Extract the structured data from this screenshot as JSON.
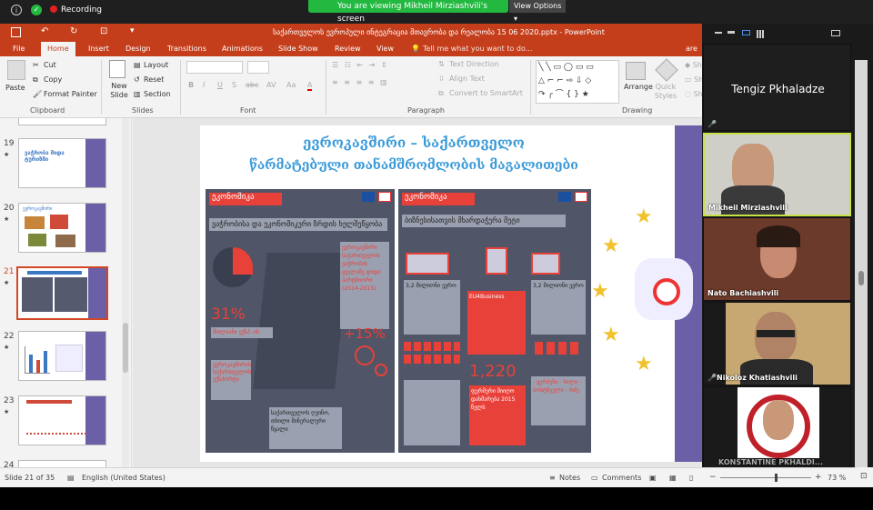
{
  "zoom": {
    "recording": "Recording",
    "viewing_banner": "You are viewing Mikheil Mirziashvili's screen",
    "view_options": "View Options"
  },
  "powerpoint": {
    "title": "საქართველოს ევროპული ინტეგრაცია მთავრობა და რეალობა 15 06 2020.pptx - PowerPoint",
    "tabs": [
      "File",
      "Home",
      "Insert",
      "Design",
      "Transitions",
      "Animations",
      "Slide Show",
      "Review",
      "View"
    ],
    "tell_me": "Tell me what you want to do...",
    "share": "are",
    "ribbon": {
      "paste": "Paste",
      "cut": "Cut",
      "copy": "Copy",
      "format_painter": "Format Painter",
      "clipboard": "Clipboard",
      "new_slide": "New Slide",
      "layout": "Layout",
      "reset": "Reset",
      "section": "Section",
      "slides": "Slides",
      "font": "Font",
      "text_direction": "Text Direction",
      "align_text": "Align Text",
      "convert_smartart": "Convert to SmartArt",
      "paragraph": "Paragraph",
      "arrange": "Arrange",
      "quick_styles": "Quick Styles",
      "drawing": "Drawing",
      "bold": "B",
      "italic": "I",
      "underline": "U",
      "strike": "S",
      "abc": "abc",
      "av": "AV",
      "aa": "Aa",
      "font_color": "A"
    },
    "thumbnails": [
      {
        "num": "19",
        "star": "★",
        "text": "ვაჭრობა შიდა ტურიზმი"
      },
      {
        "num": "20",
        "star": "★",
        "text": "ევროკავშირი"
      },
      {
        "num": "21",
        "star": "★",
        "text": ""
      },
      {
        "num": "22",
        "star": "★",
        "text": ""
      },
      {
        "num": "23",
        "star": "★",
        "text": ""
      },
      {
        "num": "24",
        "star": "★",
        "text": ""
      }
    ],
    "slide": {
      "title_line1": "ევროკავშირი – საქართველო",
      "title_line2": "წარმატებული თანამშრომლობის მაგალითები",
      "left_header": "ეკონომიკა",
      "left_subheader": "ვაჭრობისა და ეკონომიკური ზრდის ხელშეწყობა",
      "left_percent": "31%",
      "left_percent_label": "მთლიანი ექსპ.-ის",
      "left_side_text": "ევროკავშირი საქართველოს ვაჭრობის ყველაზე დიდი პარტნიორი (2014-2015)",
      "left_plus": "+15%",
      "left_bottom_text": "ევროკავშირის საქართველოს ექსპორტი",
      "left_bottom_box": "საქართველოს ღვინო, თხილი მინერალური წყალი",
      "right_header": "ეკონომიკა",
      "right_subheader": "ბიზნესისათვის მხარდაჭერა მეტი",
      "right_col1": "3,2 მილიონი ევრო",
      "right_col2": "EU4Business",
      "right_col3": "3,2 მილიონი ევრო",
      "right_number": "1,220",
      "right_num_label": "ფერმერი მიიღო დახმარება 2015 წელს",
      "right_list": "- ყურძენი - ხილი - ბოსტნეული - რძე"
    },
    "status": {
      "slide_of": "Slide 21 of 35",
      "language": "English (United States)",
      "notes": "Notes",
      "comments": "Comments",
      "zoom": "73 %"
    }
  },
  "participants": [
    {
      "name": "Tengiz Pkhaladze",
      "muted": true,
      "video": false
    },
    {
      "name": "Mikheil Mirziashvili",
      "muted": false,
      "video": true
    },
    {
      "name": "Nato Bachiashvili",
      "muted": true,
      "video": true
    },
    {
      "name": "Nikoloz Khatiashvili",
      "muted": true,
      "video": true
    },
    {
      "name": "KONSTANTINE PKHALDI...",
      "muted": false,
      "video": true
    }
  ]
}
